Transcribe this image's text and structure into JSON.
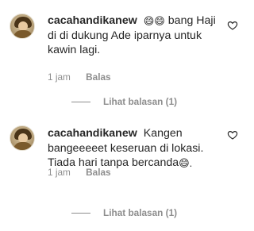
{
  "comments": [
    {
      "username": "cacahandikanew",
      "emoji_prefix": "😄😄",
      "text": "bang Haji di di dukung Ade iparnya untuk kawin lagi.",
      "emoji_suffix": "",
      "time": "1 jam",
      "reply_label": "Balas",
      "view_replies": "Lihat balasan (1)"
    },
    {
      "username": "cacahandikanew",
      "emoji_prefix": "",
      "text": "Kangen bangeeeeet keseruan di lokasi. Tiada hari tanpa bercanda",
      "emoji_suffix": "😄.",
      "time": "1 jam",
      "reply_label": "Balas",
      "view_replies": "Lihat balasan (1)"
    }
  ]
}
